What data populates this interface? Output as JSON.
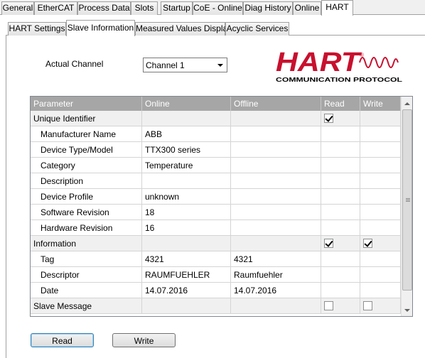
{
  "top_tabs": [
    "General",
    "EtherCAT",
    "Process Data",
    "Slots",
    "Startup",
    "CoE - Online",
    "Diag History",
    "Online",
    "HART"
  ],
  "sub_tabs": [
    "HART Settings",
    "Slave Information",
    "Measured Values Display",
    "Acyclic Services"
  ],
  "channel": {
    "label": "Actual Channel",
    "value": "Channel 1"
  },
  "logo": {
    "word": "HART",
    "reg": "®",
    "tagline": "COMMUNICATION PROTOCOL",
    "brand_color": "#c8102e"
  },
  "grid": {
    "columns": [
      "Parameter",
      "Online",
      "Offline",
      "Read",
      "Write"
    ],
    "rows": [
      {
        "param": "Unique Identifier",
        "online": "",
        "offline": "",
        "read": true,
        "write": null,
        "group": true
      },
      {
        "param": "Manufacturer Name",
        "online": "ABB",
        "offline": "",
        "read": null,
        "write": null,
        "group": false
      },
      {
        "param": "Device Type/Model",
        "online": "TTX300 series",
        "offline": "",
        "read": null,
        "write": null,
        "group": false
      },
      {
        "param": "Category",
        "online": "Temperature",
        "offline": "",
        "read": null,
        "write": null,
        "group": false
      },
      {
        "param": "Description",
        "online": "",
        "offline": "",
        "read": null,
        "write": null,
        "group": false
      },
      {
        "param": "Device Profile",
        "online": "unknown",
        "offline": "",
        "read": null,
        "write": null,
        "group": false
      },
      {
        "param": "Software Revision",
        "online": "18",
        "offline": "",
        "read": null,
        "write": null,
        "group": false
      },
      {
        "param": "Hardware Revision",
        "online": "16",
        "offline": "",
        "read": null,
        "write": null,
        "group": false
      },
      {
        "param": "Information",
        "online": "",
        "offline": "",
        "read": true,
        "write": true,
        "group": true
      },
      {
        "param": "Tag",
        "online": "4321",
        "offline": "4321",
        "read": null,
        "write": null,
        "group": false
      },
      {
        "param": "Descriptor",
        "online": "RAUMFUEHLER",
        "offline": "Raumfuehler",
        "read": null,
        "write": null,
        "group": false
      },
      {
        "param": "Date",
        "online": "14.07.2016",
        "offline": "14.07.2016",
        "read": null,
        "write": null,
        "group": false
      },
      {
        "param": "Slave Message",
        "online": "",
        "offline": "",
        "read": false,
        "write": false,
        "group": true
      }
    ]
  },
  "buttons": {
    "read": "Read",
    "write": "Write"
  }
}
